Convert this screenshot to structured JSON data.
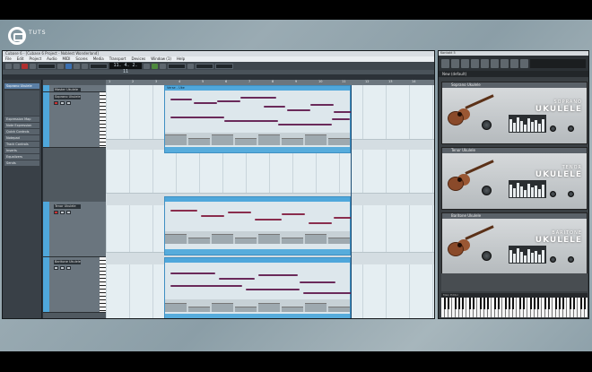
{
  "overlay": {
    "logo_text": "TUTS"
  },
  "cubase": {
    "title": "Cubase 6 - [Cubase 6 Project - Noblest Wonderland]",
    "menu": [
      "File",
      "Edit",
      "Project",
      "Audio",
      "MIDI",
      "Scores",
      "Media",
      "Transport",
      "Devices",
      "Window (1)",
      "Help"
    ],
    "counter": "11. 4. 2. 11",
    "inspector_title": "Soprano Ukulele",
    "inspector_sections": [
      "Expression Map",
      "Note Expression",
      "Quick Controls",
      "Notepad",
      "Track Controls",
      "Inserts",
      "Equalizers",
      "Sends"
    ],
    "ruler": [
      "1",
      "2",
      "3",
      "4",
      "5",
      "6",
      "7",
      "8",
      "9",
      "10",
      "11",
      "12",
      "13",
      "14",
      "15"
    ],
    "tracks": [
      {
        "name": "Soprano Ukulele",
        "folder": "Master Ukulele"
      },
      {
        "name": "Tenor Ukulele"
      },
      {
        "name": "Baritone Ukulele"
      }
    ],
    "part_name": "Verse - Uke"
  },
  "kontakt": {
    "title": "Kontakt 5",
    "multi": "New (default)",
    "instruments": [
      {
        "name": "Soprano Ukulele",
        "line1": "SOPRANO",
        "line2": "UKULELE"
      },
      {
        "name": "Tenor Ukulele",
        "line1": "TENOR",
        "line2": "UKULELE"
      },
      {
        "name": "Baritone Ukulele",
        "line1": "BARITONE",
        "line2": "UKULELE"
      }
    ],
    "keyboard_label": "Main Editor"
  }
}
